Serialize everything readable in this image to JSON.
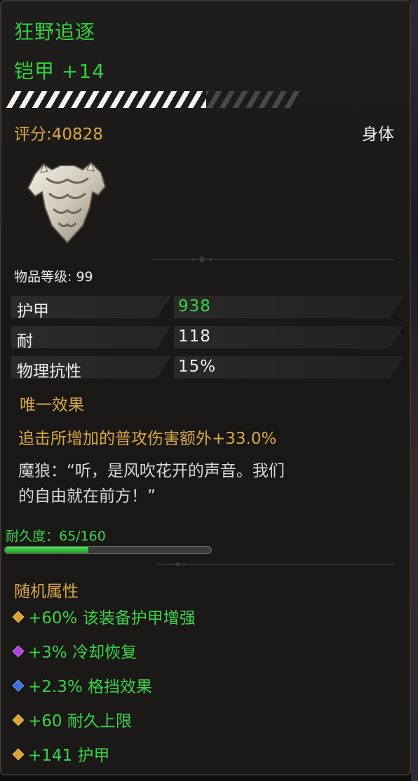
{
  "item": {
    "name": "狂野追逐",
    "type_enhance": "铠甲 +14",
    "upgrade_progress": 0.68,
    "score": "评分:40828",
    "slot": "身体",
    "item_level": "物品等级: 99"
  },
  "stats": [
    {
      "label": "护甲",
      "value": "938",
      "highlight": true
    },
    {
      "label": "耐",
      "value": "118",
      "highlight": false
    },
    {
      "label": "物理抗性",
      "value": "15%",
      "highlight": false
    }
  ],
  "unique": {
    "title": "唯一效果",
    "description": "追击所增加的普攻伤害额外+33.0%"
  },
  "flavor": {
    "line1": "魔狼：“听，是风吹花开的声音。我们",
    "line2": "的自由就在前方！”"
  },
  "durability": {
    "label": "耐久度：65/160",
    "current": 65,
    "max": 160
  },
  "random_attributes": {
    "title": "随机属性",
    "items": [
      {
        "text": "+60% 该装备护甲增强",
        "gem_color": "#e0a030"
      },
      {
        "text": "+3% 冷却恢复",
        "gem_color": "#b040e0"
      },
      {
        "text": "+2.3% 格挡效果",
        "gem_color": "#3a70e0"
      },
      {
        "text": "+60 耐久上限",
        "gem_color": "#e0a030"
      },
      {
        "text": "+141 护甲",
        "gem_color": "#e0a030"
      }
    ]
  },
  "icons": {
    "item_image": "chest-armor-icon",
    "gem": "diamond-gem-icon"
  }
}
